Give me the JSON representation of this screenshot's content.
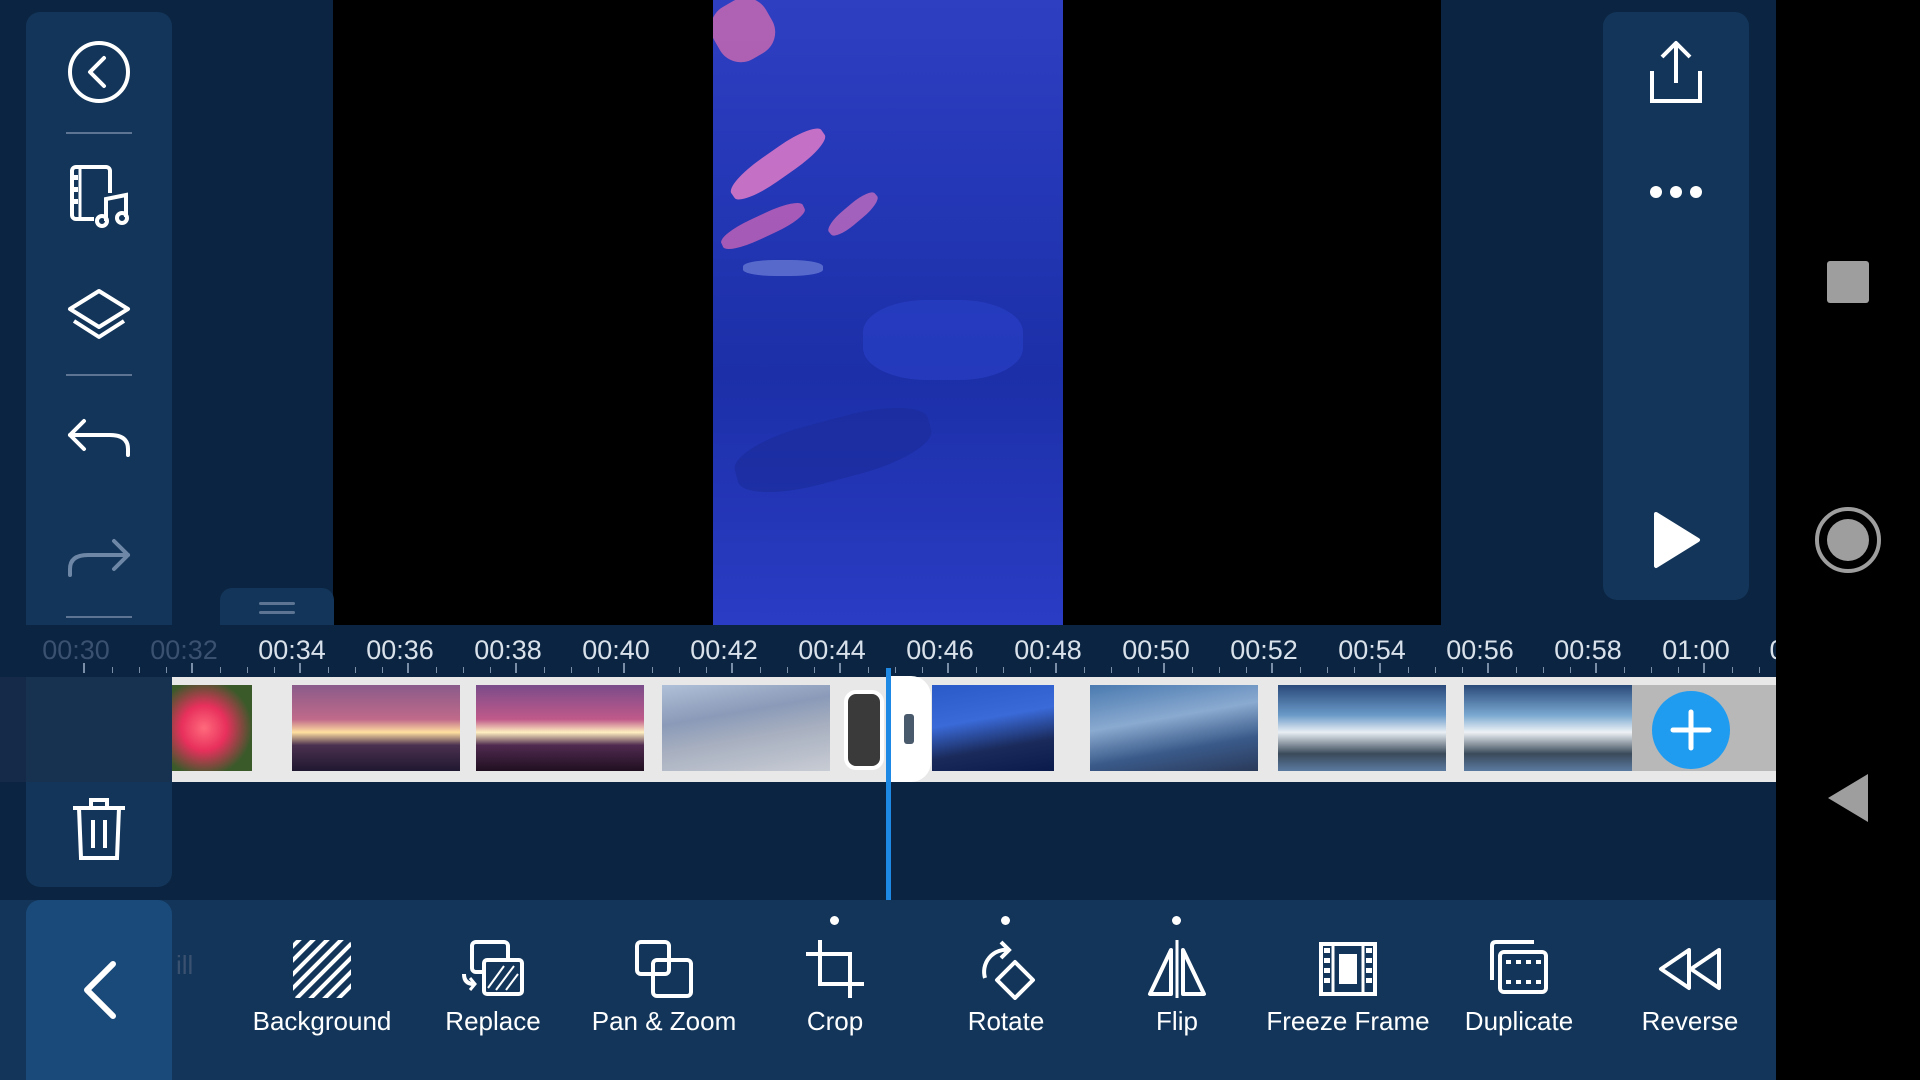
{
  "app": {
    "tools": [
      {
        "label": "Background",
        "icon": "hatch-icon"
      },
      {
        "label": "Replace",
        "icon": "replace-icon"
      },
      {
        "label": "Pan & Zoom",
        "icon": "pan-zoom-icon"
      },
      {
        "label": "Crop",
        "icon": "crop-icon"
      },
      {
        "label": "Rotate",
        "icon": "rotate-icon"
      },
      {
        "label": "Flip",
        "icon": "flip-icon"
      },
      {
        "label": "Freeze Frame",
        "icon": "film-frame-icon"
      },
      {
        "label": "Duplicate",
        "icon": "duplicate-icon"
      },
      {
        "label": "Reverse",
        "icon": "rewind-icon"
      }
    ],
    "partial_tool_label": "ill",
    "timeline": {
      "ticks": [
        "00:30",
        "00:32",
        "00:34",
        "00:36",
        "00:38",
        "00:40",
        "00:42",
        "00:44",
        "00:46",
        "00:48",
        "00:50",
        "00:52",
        "00:54",
        "00:56",
        "00:58",
        "01:00",
        "0"
      ]
    }
  },
  "colors": {
    "background": "#0b2441",
    "panel": "#123559",
    "accent": "#1f9cf0",
    "playhead": "#1e88e5"
  }
}
